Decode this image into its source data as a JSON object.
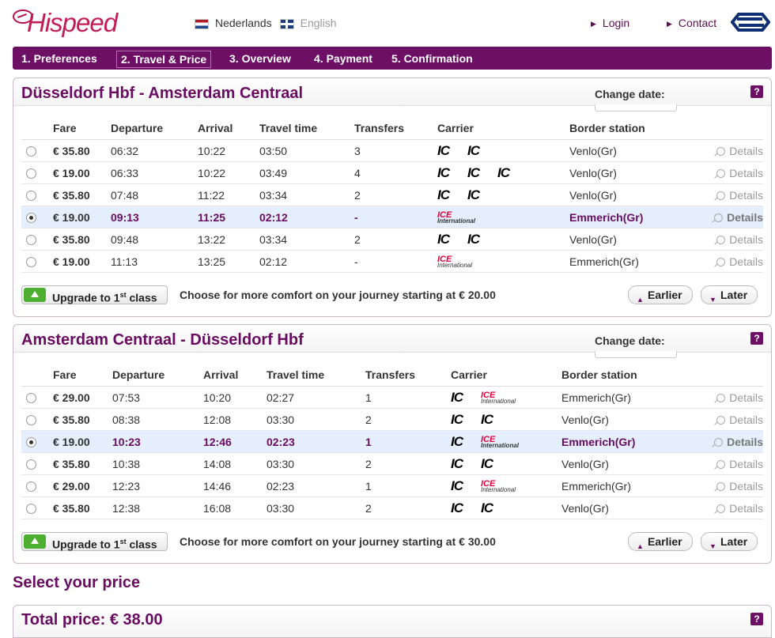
{
  "header": {
    "brand": "Hispeed",
    "languages": [
      "Nederlands",
      "English"
    ],
    "login": "Login",
    "contact": "Contact"
  },
  "steps": [
    "1. Preferences",
    "2. Travel & Price",
    "3. Overview",
    "4. Payment",
    "5. Confirmation"
  ],
  "active_step": "2. Travel & Price",
  "columns": [
    "Fare",
    "Departure",
    "Arrival",
    "Travel time",
    "Transfers",
    "Carrier",
    "Border station"
  ],
  "change_date_label": "Change date:",
  "help": "?",
  "details_label": "Details",
  "earlier": "Earlier",
  "later": "Later",
  "upgrade": {
    "prefix": "Upgrade to 1",
    "sup": "st",
    "suffix": " class"
  },
  "outbound": {
    "title": "Düsseldorf Hbf - Amsterdam Centraal",
    "comfort": "Choose for more comfort on your journey starting at € 20.00",
    "rows": [
      {
        "fare": "€ 35.80",
        "dep": "06:32",
        "arr": "10:22",
        "time": "03:50",
        "transfers": "3",
        "carriers": [
          "IC",
          "IC"
        ],
        "border": "Venlo(Gr)"
      },
      {
        "fare": "€ 19.00",
        "dep": "06:33",
        "arr": "10:22",
        "time": "03:49",
        "transfers": "4",
        "carriers": [
          "IC",
          "IC",
          "IC"
        ],
        "border": "Venlo(Gr)"
      },
      {
        "fare": "€ 35.80",
        "dep": "07:48",
        "arr": "11:22",
        "time": "03:34",
        "transfers": "2",
        "carriers": [
          "IC",
          "IC"
        ],
        "border": "Venlo(Gr)"
      },
      {
        "fare": "€ 19.00",
        "dep": "09:13",
        "arr": "11:25",
        "time": "02:12",
        "transfers": "-",
        "carriers": [
          "ICE"
        ],
        "border": "Emmerich(Gr)",
        "selected": true
      },
      {
        "fare": "€ 35.80",
        "dep": "09:48",
        "arr": "13:22",
        "time": "03:34",
        "transfers": "2",
        "carriers": [
          "IC",
          "IC"
        ],
        "border": "Venlo(Gr)"
      },
      {
        "fare": "€ 19.00",
        "dep": "11:13",
        "arr": "13:25",
        "time": "02:12",
        "transfers": "-",
        "carriers": [
          "ICE"
        ],
        "border": "Emmerich(Gr)"
      }
    ]
  },
  "return": {
    "title": "Amsterdam Centraal - Düsseldorf Hbf",
    "comfort": "Choose for more comfort on your journey starting at € 30.00",
    "rows": [
      {
        "fare": "€ 29.00",
        "dep": "07:53",
        "arr": "10:20",
        "time": "02:27",
        "transfers": "1",
        "carriers": [
          "IC",
          "ICE"
        ],
        "border": "Emmerich(Gr)"
      },
      {
        "fare": "€ 35.80",
        "dep": "08:38",
        "arr": "12:08",
        "time": "03:30",
        "transfers": "2",
        "carriers": [
          "IC",
          "IC"
        ],
        "border": "Venlo(Gr)"
      },
      {
        "fare": "€ 19.00",
        "dep": "10:23",
        "arr": "12:46",
        "time": "02:23",
        "transfers": "1",
        "carriers": [
          "IC",
          "ICE"
        ],
        "border": "Emmerich(Gr)",
        "selected": true
      },
      {
        "fare": "€ 35.80",
        "dep": "10:38",
        "arr": "14:08",
        "time": "03:30",
        "transfers": "2",
        "carriers": [
          "IC",
          "IC"
        ],
        "border": "Venlo(Gr)"
      },
      {
        "fare": "€ 29.00",
        "dep": "12:23",
        "arr": "14:46",
        "time": "02:23",
        "transfers": "1",
        "carriers": [
          "IC",
          "ICE"
        ],
        "border": "Emmerich(Gr)"
      },
      {
        "fare": "€ 35.80",
        "dep": "12:38",
        "arr": "16:08",
        "time": "03:30",
        "transfers": "2",
        "carriers": [
          "IC",
          "IC"
        ],
        "border": "Venlo(Gr)"
      }
    ]
  },
  "select_price": "Select your price",
  "total_price": "Total price: € 38.00",
  "ice_logo": {
    "top": "ICE",
    "bottom": "International"
  },
  "colors": {
    "brand_purple": "#6e0f66",
    "brand_red": "#c21d55",
    "selected_row": "#e4eefc",
    "upgrade_green": "#4caf2f"
  }
}
